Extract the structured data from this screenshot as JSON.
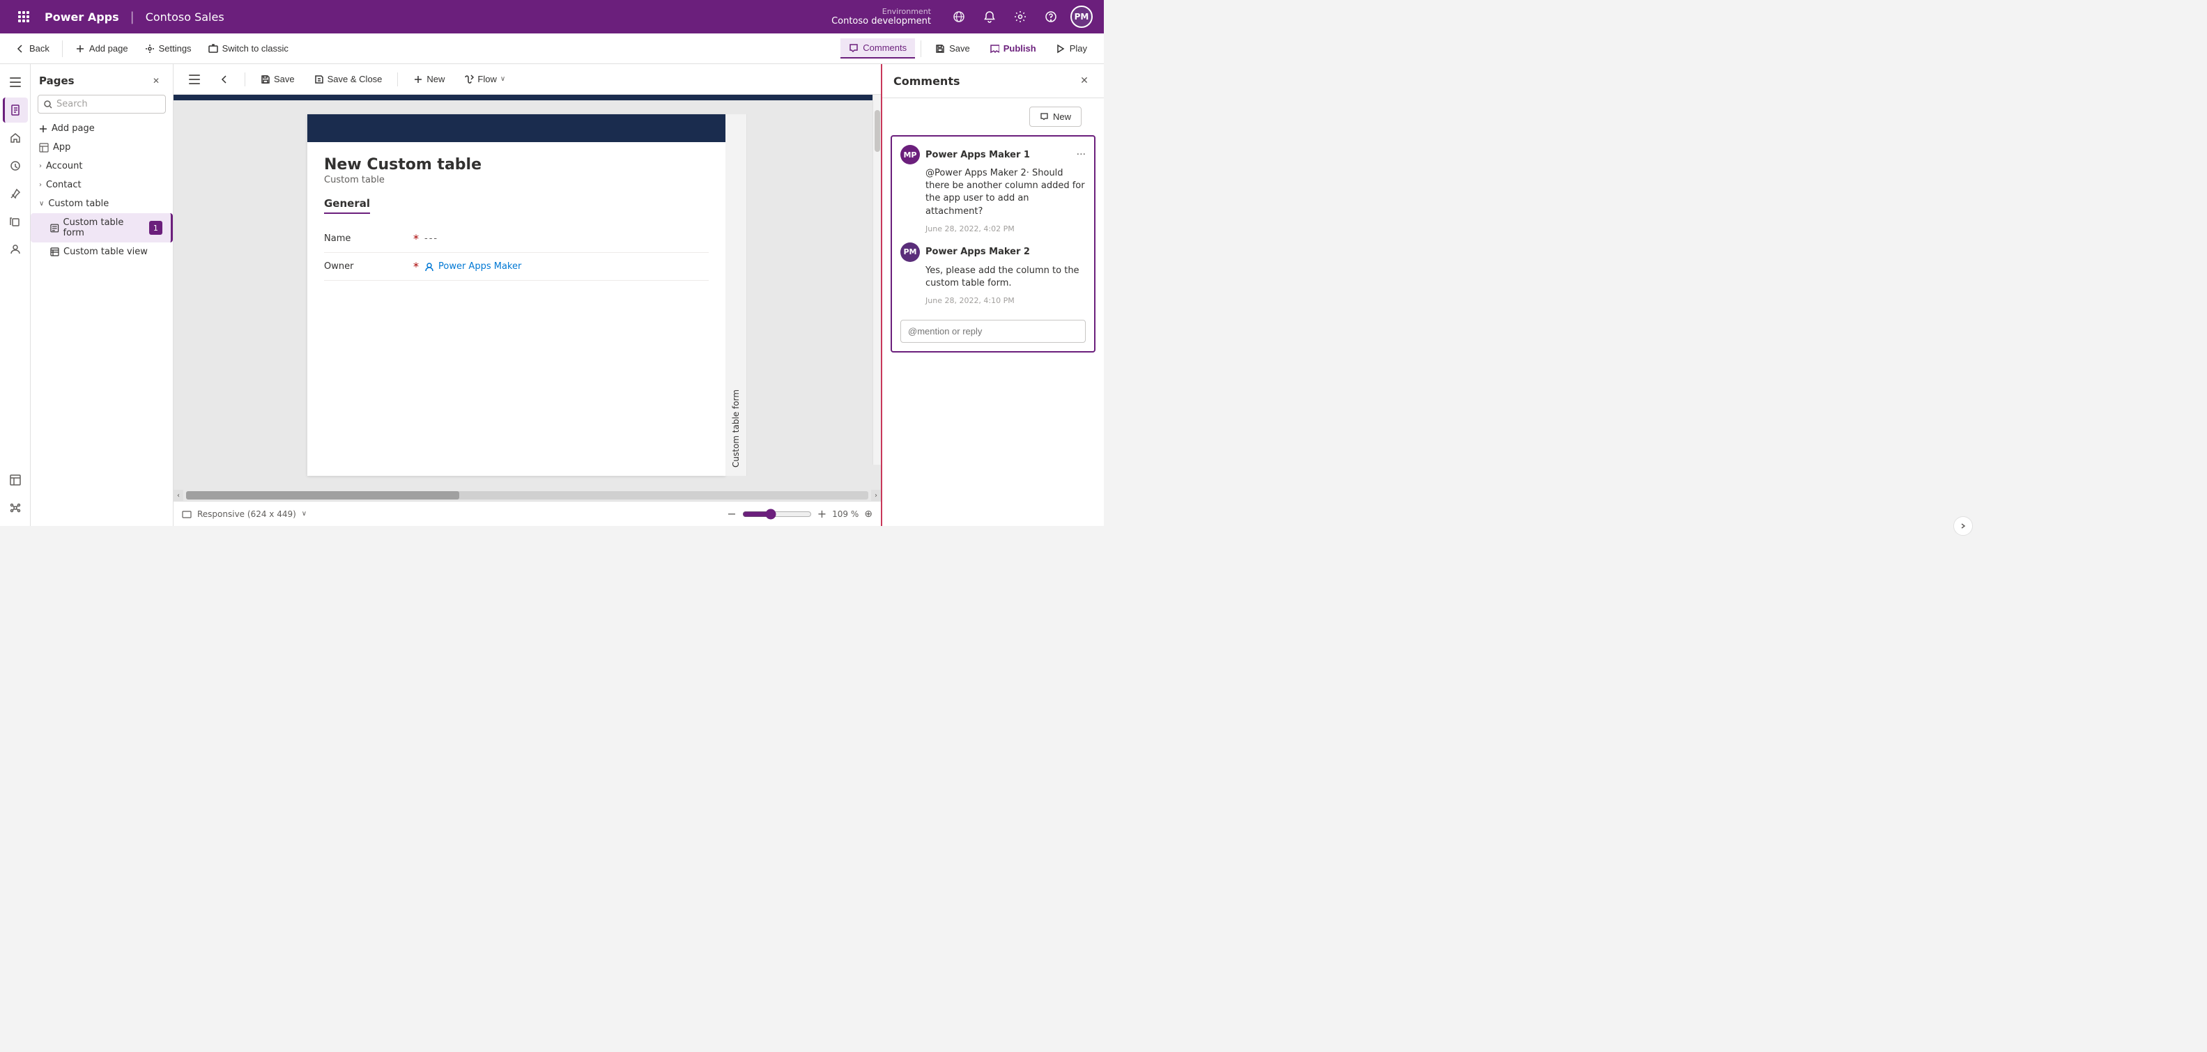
{
  "topnav": {
    "grid_icon": "⊞",
    "app_name": "Power Apps",
    "separator": "|",
    "project_name": "Contoso Sales",
    "env_label": "Environment",
    "env_name": "Contoso development",
    "bell_icon": "🔔",
    "gear_icon": "⚙",
    "help_icon": "?",
    "avatar_text": "PM"
  },
  "second_toolbar": {
    "back_label": "Back",
    "add_page_label": "Add page",
    "settings_label": "Settings",
    "switch_label": "Switch to classic",
    "comments_label": "Comments",
    "save_label": "Save",
    "publish_label": "Publish",
    "play_label": "Play"
  },
  "pages_panel": {
    "title": "Pages",
    "close_icon": "✕",
    "search_placeholder": "Search",
    "add_page_label": "Add page",
    "items": [
      {
        "label": "App",
        "indent": 0,
        "icon": "□",
        "expandable": false,
        "selected": false
      },
      {
        "label": "Account",
        "indent": 0,
        "icon": "›",
        "expandable": true,
        "selected": false
      },
      {
        "label": "Contact",
        "indent": 0,
        "icon": "›",
        "expandable": true,
        "selected": false
      },
      {
        "label": "Custom table",
        "indent": 0,
        "icon": "∨",
        "expandable": true,
        "selected": false
      },
      {
        "label": "Custom table form",
        "indent": 1,
        "icon": "📄",
        "expandable": false,
        "selected": true,
        "badge": "1"
      },
      {
        "label": "Custom table view",
        "indent": 1,
        "icon": "⊞",
        "expandable": false,
        "selected": false
      }
    ]
  },
  "form_toolbar": {
    "menu_icon": "≡",
    "back_icon": "←",
    "save_label": "Save",
    "save_close_label": "Save & Close",
    "new_label": "New",
    "flow_label": "Flow",
    "dropdown_icon": "∨"
  },
  "form_content": {
    "title": "New Custom table",
    "subtitle": "Custom table",
    "tab": "General",
    "fields": [
      {
        "label": "Name",
        "required": true,
        "value": "---",
        "is_link": false
      },
      {
        "label": "Owner",
        "required": true,
        "value": "Power Apps Maker",
        "is_link": true
      }
    ]
  },
  "vertical_tab": {
    "label": "Custom table form"
  },
  "bottom_bar": {
    "responsive_label": "Responsive (624 x 449)",
    "dropdown_icon": "∨",
    "minus_label": "−",
    "zoom_value": "109 %",
    "plus_label": "+",
    "target_icon": "⊕"
  },
  "comments_panel": {
    "title": "Comments",
    "close_icon": "✕",
    "new_button_label": "New",
    "thread": {
      "comment1": {
        "avatar": "MP",
        "author": "Power Apps Maker 1",
        "text": "@Power Apps Maker 2· Should there be another column added for the app user to add an attachment?",
        "time": "June 28, 2022, 4:02 PM"
      },
      "comment2": {
        "avatar": "PM",
        "author": "Power Apps Maker 2",
        "text": "Yes, please add the column to the custom table form.",
        "time": "June 28, 2022, 4:10 PM"
      }
    },
    "reply_placeholder": "@mention or reply"
  },
  "colors": {
    "brand_purple": "#6b1f7c",
    "nav_bg": "#6b1f7c",
    "accent_red": "#c8385a",
    "link_blue": "#0078d4"
  }
}
